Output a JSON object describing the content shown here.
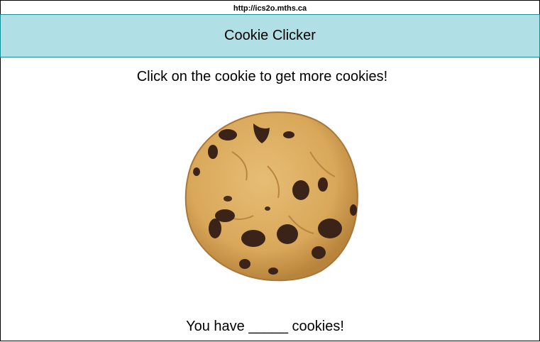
{
  "browser": {
    "url": "http://ics2o.mths.ca"
  },
  "header": {
    "title": "Cookie Clicker",
    "background_color": "#b0e0e6"
  },
  "main": {
    "instruction": "Click on the cookie to get more cookies!",
    "cookie_image": {
      "icon": "chocolate-chip-cookie",
      "dough_color": "#d9a85a",
      "chip_color": "#3b2417"
    },
    "counter": {
      "prefix": "You have",
      "count_placeholder": "_____",
      "suffix": "cookies!"
    }
  }
}
